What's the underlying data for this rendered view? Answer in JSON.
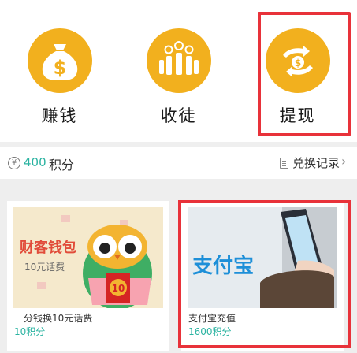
{
  "features": [
    {
      "label": "赚钱",
      "icon": "money-bag-icon"
    },
    {
      "label": "收徒",
      "icon": "people-money-icon"
    },
    {
      "label": "提现",
      "icon": "hand-cash-icon"
    }
  ],
  "points": {
    "value": "400",
    "unit": "积分",
    "coin_symbol": "¥"
  },
  "history_link": {
    "label": "兑换记录",
    "chevron": "›"
  },
  "products": [
    {
      "banner_title": "财客钱包",
      "banner_subtitle": "10元话费",
      "badge": "10",
      "name": "一分钱换10元话费",
      "price": "10积分"
    },
    {
      "banner_logo": "支付宝",
      "name": "支付宝充值",
      "price": "1600积分"
    }
  ],
  "colors": {
    "accent": "#2bb3a1",
    "icon_bg": "#f2b01e",
    "highlight": "#e8323a"
  }
}
